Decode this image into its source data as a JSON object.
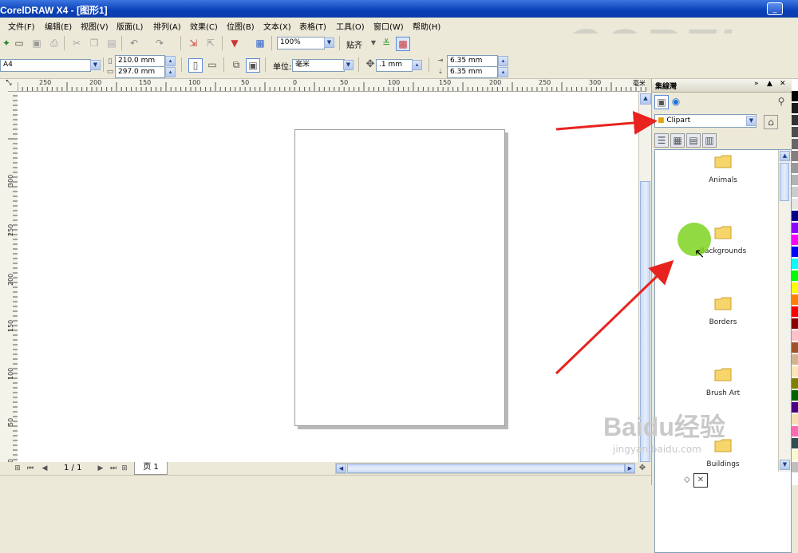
{
  "window": {
    "title": "CorelDRAW X4 - [图形1]",
    "brand_logo": "COREL",
    "controls": [
      "minimize-icon",
      "maximize-icon",
      "close-icon"
    ]
  },
  "menu": [
    "文件(F)",
    "编辑(E)",
    "视图(V)",
    "版面(L)",
    "排列(A)",
    "效果(C)",
    "位图(B)",
    "文本(X)",
    "表格(T)",
    "工具(O)",
    "窗口(W)",
    "帮助(H)"
  ],
  "toolbar": {
    "zoom_value": "100%",
    "snap_label": "贴齐"
  },
  "property_bar": {
    "paper_size": "A4",
    "width": "210.0 mm",
    "height": "297.0 mm",
    "units_label": "单位:",
    "units_value": "毫米",
    "nudge": ".1 mm",
    "dup_x": "6.35 mm",
    "dup_y": "6.35 mm"
  },
  "rulers": {
    "h_labels": [
      "250",
      "200",
      "150",
      "100",
      "50",
      "0",
      "50",
      "100",
      "150",
      "200",
      "250",
      "300"
    ],
    "v_labels": [
      "300",
      "250",
      "200",
      "150",
      "100",
      "50",
      "0"
    ],
    "unit": "毫米"
  },
  "page_nav": {
    "counter": "1 / 1",
    "tab": "页 1"
  },
  "docker": {
    "title": "集線灣",
    "source": "Clipart",
    "folders": [
      "Animals",
      "Backgrounds",
      "Borders",
      "Brush Art",
      "Buildings"
    ]
  },
  "palette_colors": [
    "#ffffff",
    "#000000",
    "#1a1a1a",
    "#333333",
    "#4d4d4d",
    "#666666",
    "#808080",
    "#999999",
    "#b3b3b3",
    "#cccccc",
    "#e6e6e6",
    "#00008b",
    "#8b00ff",
    "#ff00ff",
    "#0000ff",
    "#00ffff",
    "#00ff00",
    "#ffff00",
    "#ff8000",
    "#ff0000",
    "#8b0000",
    "#ffc0cb",
    "#a0522d",
    "#d2b48c",
    "#ffe4b5",
    "#808000",
    "#006400",
    "#4b0082",
    "#f5deb3",
    "#ff69b4",
    "#2f4f4f",
    "#fafad2",
    "#c0c0c0"
  ],
  "accent": {
    "arrow": "#e8231f",
    "cursor_highlight": "#7ed321"
  },
  "watermark": {
    "brand": "Baidu经验",
    "url": "jingyan.baidu.com"
  }
}
